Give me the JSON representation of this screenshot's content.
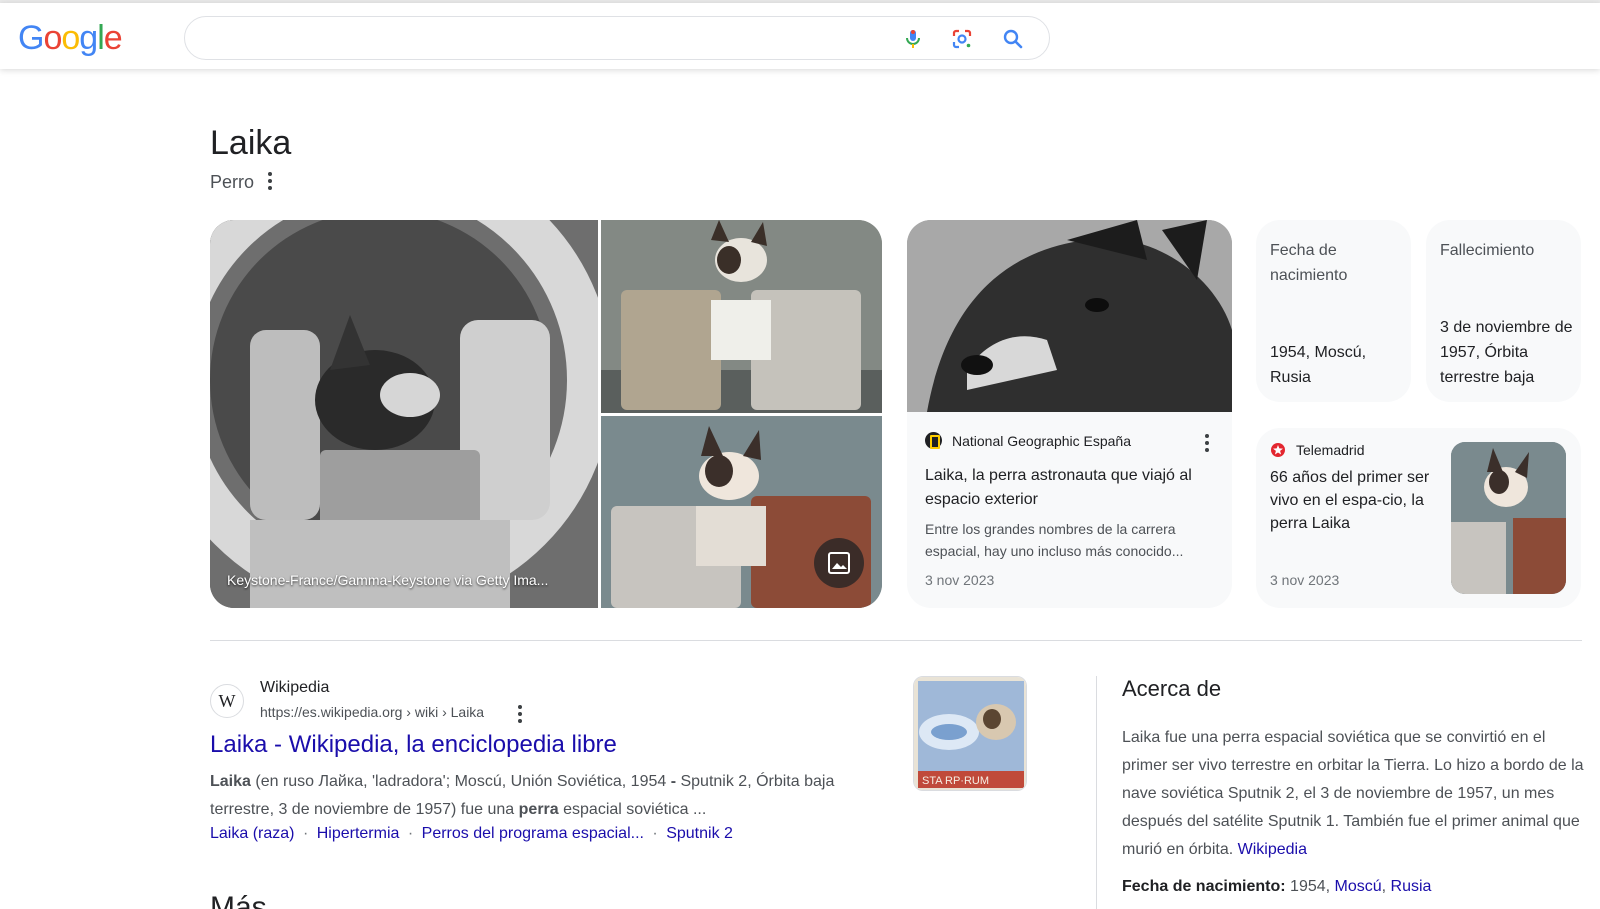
{
  "header": {
    "logo": "Google",
    "search_value": "",
    "icons": [
      "mic-icon",
      "lens-icon",
      "search-icon"
    ],
    "colors": {
      "blue": "#4285f4",
      "red": "#ea4335",
      "yellow": "#fbbc05",
      "green": "#34a853"
    }
  },
  "entity": {
    "title": "Laika",
    "subtitle": "Perro"
  },
  "images": {
    "main_caption": "Keystone-France/Gamma-Keystone via Getty Ima..."
  },
  "news": [
    {
      "source": "National Geographic España",
      "title": "Laika, la perra astronauta que viajó al espacio exterior",
      "snippet": "Entre los grandes nombres de la carrera espacial, hay uno incluso más conocido...",
      "date": "3 nov 2023"
    },
    {
      "source": "Telemadrid",
      "title": "66 años del primer ser vivo en el espa-cio, la perra Laika",
      "date": "3 nov 2023"
    }
  ],
  "facts": [
    {
      "label": "Fecha de nacimiento",
      "value": "1954, Moscú, Rusia"
    },
    {
      "label": "Fallecimiento",
      "value": "3 de noviembre de 1957, Órbita terrestre baja"
    }
  ],
  "result": {
    "site": "Wikipedia",
    "favicon": "W",
    "url": "https://es.wikipedia.org › wiki › Laika",
    "title": "Laika - Wikipedia, la enciclopedia libre",
    "snippet_parts": [
      {
        "b": "Laika"
      },
      {
        "t": " (en ruso Лайка, 'ladradora'; Moscú, Unión Soviética, 1954 "
      },
      {
        "b": "-"
      },
      {
        "t": " Sputnik 2, Órbita baja terrestre, 3 de noviembre de 1957) fue una "
      },
      {
        "b": "perra"
      },
      {
        "t": " espacial soviética ..."
      }
    ],
    "sitelinks": [
      "Laika (raza)",
      "Hipertermia",
      "Perros del programa espacial...",
      "Sputnik 2"
    ],
    "sitelink_separator": "·"
  },
  "more_heading": "Más preguntas",
  "about": {
    "heading": "Acerca de",
    "text": "Laika fue una perra espacial soviética que se convirtió en el primer ser vivo terrestre en orbitar la Tierra. Lo hizo a bordo de la nave soviética Sputnik 2, el 3 de noviembre de 1957, un mes después del satélite Sputnik 1. También fue el primer animal que murió en órbita.",
    "source_link": "Wikipedia",
    "fact_label": "Fecha de nacimiento:",
    "fact_year": "1954",
    "fact_links": [
      "Moscú",
      "Rusia"
    ]
  }
}
